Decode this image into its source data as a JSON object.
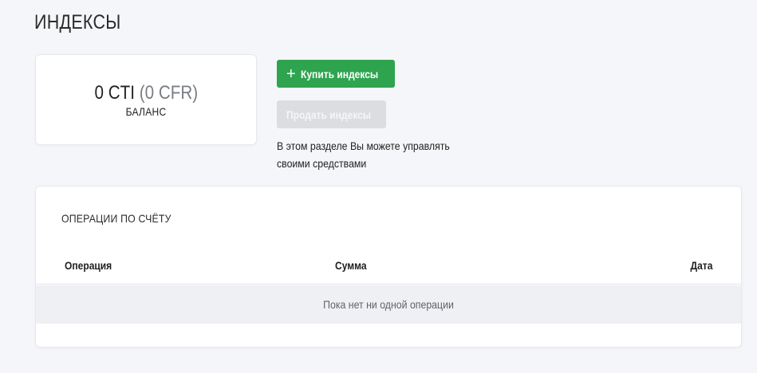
{
  "page": {
    "title": "ИНДЕКСЫ"
  },
  "balance": {
    "amount_cti": "0 CTI",
    "amount_cfr": "(0 CFR)",
    "label": "БАЛАНС"
  },
  "actions": {
    "buy_label": "Купить индексы",
    "sell_label": "Продать индексы",
    "info_text": "В этом разделе Вы можете управлять своими средствами"
  },
  "operations": {
    "title": "ОПЕРАЦИИ ПО СЧЁТУ",
    "columns": [
      "Операция",
      "Сумма",
      "Дата"
    ],
    "empty_message": "Пока нет ни одной операции"
  },
  "colors": {
    "accent": "#2ea44f",
    "disabled": "#dcdde1",
    "background": "#f5f6f9"
  }
}
